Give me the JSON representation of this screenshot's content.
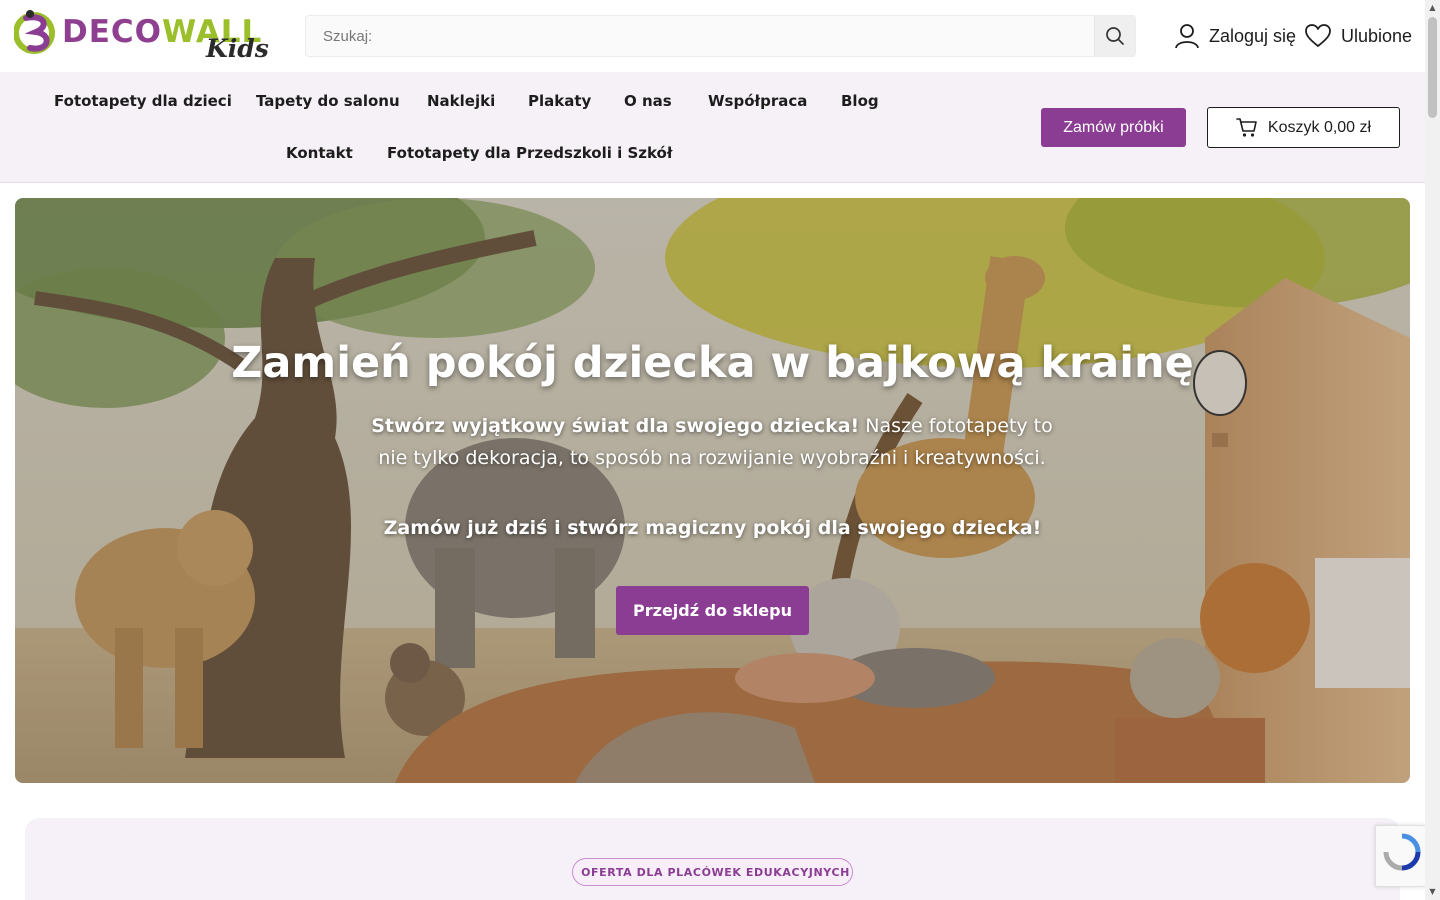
{
  "header": {
    "logo_main_1": "DECO",
    "logo_main_2": "WALL",
    "logo_sub": "Kids",
    "search_placeholder": "Szukaj:",
    "login_label": "Zaloguj się",
    "favorites_label": "Ulubione"
  },
  "nav": {
    "items": [
      "Fototapety dla dzieci",
      "Tapety do salonu",
      "Naklejki",
      "Plakaty",
      "O nas",
      "Współpraca",
      "Blog",
      "Kontakt",
      "Fototapety dla Przedszkoli i Szkół"
    ],
    "samples_button": "Zamów próbki",
    "cart_label": "Koszyk 0,00 zł"
  },
  "hero": {
    "title": "Zamień pokój dziecka w bajkową krainę",
    "subtitle_bold": "Stwórz wyjątkowy świat dla swojego dziecka!",
    "subtitle_rest": " Nasze fototapety to nie tylko dekoracja, to sposób na rozwijanie wyobraźni i kreatywności.",
    "cta_text": "Zamów już dziś i stwórz magiczny pokój dla swojego dziecka!",
    "button_label": "Przejdź do sklepu"
  },
  "offer": {
    "badge_icon": "",
    "badge_label": "OFERTA DLA PLACÓWEK EDUKACYJNYCH"
  },
  "colors": {
    "brand_purple": "#8b3d93",
    "brand_green": "#9bbf2a",
    "nav_background": "#f6f1f6"
  }
}
